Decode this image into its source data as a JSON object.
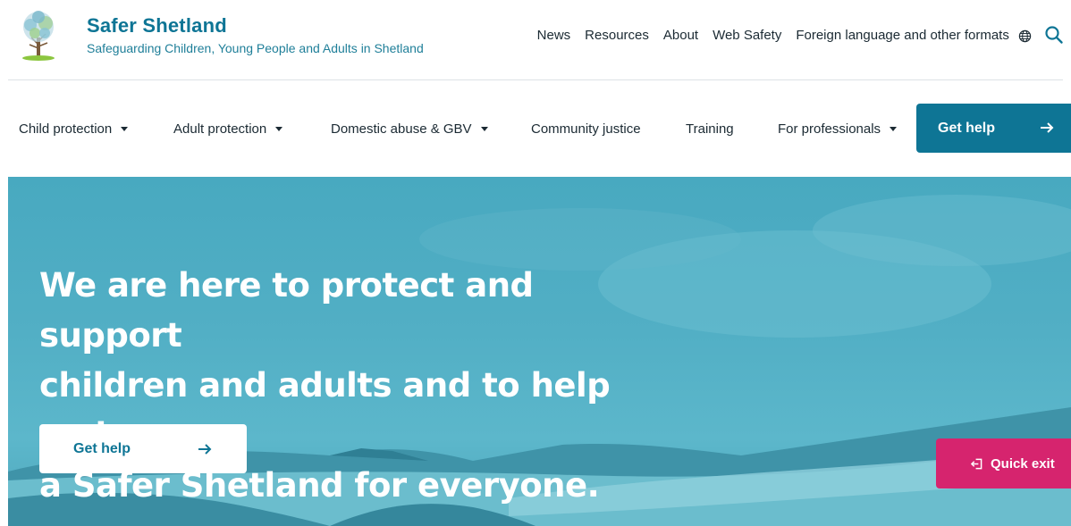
{
  "brand": {
    "name": "Safer Shetland",
    "tagline": "Safeguarding Children, Young People and Adults in Shetland"
  },
  "utility_nav": [
    {
      "label": "News"
    },
    {
      "label": "Resources"
    },
    {
      "label": "About"
    },
    {
      "label": "Web Safety"
    },
    {
      "label": "Foreign language and other formats",
      "icon": "globe-icon"
    }
  ],
  "search": {
    "icon": "search-icon"
  },
  "main_nav": [
    {
      "label": "Child protection",
      "has_dropdown": true
    },
    {
      "label": "Adult protection",
      "has_dropdown": true
    },
    {
      "label": "Domestic abuse & GBV",
      "has_dropdown": true
    },
    {
      "label": "Community justice",
      "has_dropdown": false
    },
    {
      "label": "Training",
      "has_dropdown": false
    },
    {
      "label": "For professionals",
      "has_dropdown": true
    }
  ],
  "nav_cta": {
    "label": "Get help",
    "icon": "arrow-right-icon"
  },
  "hero": {
    "title_lines": [
      "We are here to protect and support",
      "children and adults and to help make",
      "a Safer Shetland for everyone."
    ],
    "button": {
      "label": "Get help",
      "icon": "arrow-right-icon"
    }
  },
  "quick_exit": {
    "label": "Quick exit",
    "icon": "exit-icon"
  },
  "colors": {
    "brand_teal": "#0e7595",
    "hero_blue": "#52afc5",
    "quick_exit_pink": "#d6246e"
  }
}
